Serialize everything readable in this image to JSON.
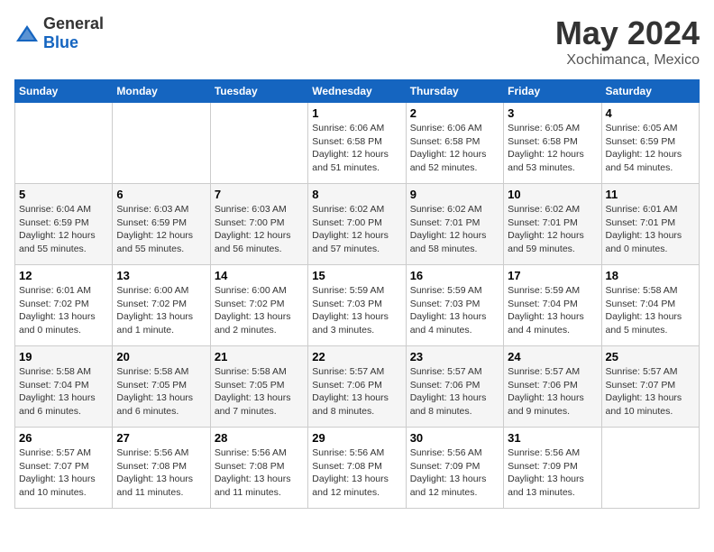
{
  "logo": {
    "general": "General",
    "blue": "Blue"
  },
  "title": "May 2024",
  "subtitle": "Xochimanca, Mexico",
  "days_of_week": [
    "Sunday",
    "Monday",
    "Tuesday",
    "Wednesday",
    "Thursday",
    "Friday",
    "Saturday"
  ],
  "weeks": [
    [
      {
        "day": "",
        "info": ""
      },
      {
        "day": "",
        "info": ""
      },
      {
        "day": "",
        "info": ""
      },
      {
        "day": "1",
        "info": "Sunrise: 6:06 AM\nSunset: 6:58 PM\nDaylight: 12 hours\nand 51 minutes."
      },
      {
        "day": "2",
        "info": "Sunrise: 6:06 AM\nSunset: 6:58 PM\nDaylight: 12 hours\nand 52 minutes."
      },
      {
        "day": "3",
        "info": "Sunrise: 6:05 AM\nSunset: 6:58 PM\nDaylight: 12 hours\nand 53 minutes."
      },
      {
        "day": "4",
        "info": "Sunrise: 6:05 AM\nSunset: 6:59 PM\nDaylight: 12 hours\nand 54 minutes."
      }
    ],
    [
      {
        "day": "5",
        "info": "Sunrise: 6:04 AM\nSunset: 6:59 PM\nDaylight: 12 hours\nand 55 minutes."
      },
      {
        "day": "6",
        "info": "Sunrise: 6:03 AM\nSunset: 6:59 PM\nDaylight: 12 hours\nand 55 minutes."
      },
      {
        "day": "7",
        "info": "Sunrise: 6:03 AM\nSunset: 7:00 PM\nDaylight: 12 hours\nand 56 minutes."
      },
      {
        "day": "8",
        "info": "Sunrise: 6:02 AM\nSunset: 7:00 PM\nDaylight: 12 hours\nand 57 minutes."
      },
      {
        "day": "9",
        "info": "Sunrise: 6:02 AM\nSunset: 7:01 PM\nDaylight: 12 hours\nand 58 minutes."
      },
      {
        "day": "10",
        "info": "Sunrise: 6:02 AM\nSunset: 7:01 PM\nDaylight: 12 hours\nand 59 minutes."
      },
      {
        "day": "11",
        "info": "Sunrise: 6:01 AM\nSunset: 7:01 PM\nDaylight: 13 hours\nand 0 minutes."
      }
    ],
    [
      {
        "day": "12",
        "info": "Sunrise: 6:01 AM\nSunset: 7:02 PM\nDaylight: 13 hours\nand 0 minutes."
      },
      {
        "day": "13",
        "info": "Sunrise: 6:00 AM\nSunset: 7:02 PM\nDaylight: 13 hours\nand 1 minute."
      },
      {
        "day": "14",
        "info": "Sunrise: 6:00 AM\nSunset: 7:02 PM\nDaylight: 13 hours\nand 2 minutes."
      },
      {
        "day": "15",
        "info": "Sunrise: 5:59 AM\nSunset: 7:03 PM\nDaylight: 13 hours\nand 3 minutes."
      },
      {
        "day": "16",
        "info": "Sunrise: 5:59 AM\nSunset: 7:03 PM\nDaylight: 13 hours\nand 4 minutes."
      },
      {
        "day": "17",
        "info": "Sunrise: 5:59 AM\nSunset: 7:04 PM\nDaylight: 13 hours\nand 4 minutes."
      },
      {
        "day": "18",
        "info": "Sunrise: 5:58 AM\nSunset: 7:04 PM\nDaylight: 13 hours\nand 5 minutes."
      }
    ],
    [
      {
        "day": "19",
        "info": "Sunrise: 5:58 AM\nSunset: 7:04 PM\nDaylight: 13 hours\nand 6 minutes."
      },
      {
        "day": "20",
        "info": "Sunrise: 5:58 AM\nSunset: 7:05 PM\nDaylight: 13 hours\nand 6 minutes."
      },
      {
        "day": "21",
        "info": "Sunrise: 5:58 AM\nSunset: 7:05 PM\nDaylight: 13 hours\nand 7 minutes."
      },
      {
        "day": "22",
        "info": "Sunrise: 5:57 AM\nSunset: 7:06 PM\nDaylight: 13 hours\nand 8 minutes."
      },
      {
        "day": "23",
        "info": "Sunrise: 5:57 AM\nSunset: 7:06 PM\nDaylight: 13 hours\nand 8 minutes."
      },
      {
        "day": "24",
        "info": "Sunrise: 5:57 AM\nSunset: 7:06 PM\nDaylight: 13 hours\nand 9 minutes."
      },
      {
        "day": "25",
        "info": "Sunrise: 5:57 AM\nSunset: 7:07 PM\nDaylight: 13 hours\nand 10 minutes."
      }
    ],
    [
      {
        "day": "26",
        "info": "Sunrise: 5:57 AM\nSunset: 7:07 PM\nDaylight: 13 hours\nand 10 minutes."
      },
      {
        "day": "27",
        "info": "Sunrise: 5:56 AM\nSunset: 7:08 PM\nDaylight: 13 hours\nand 11 minutes."
      },
      {
        "day": "28",
        "info": "Sunrise: 5:56 AM\nSunset: 7:08 PM\nDaylight: 13 hours\nand 11 minutes."
      },
      {
        "day": "29",
        "info": "Sunrise: 5:56 AM\nSunset: 7:08 PM\nDaylight: 13 hours\nand 12 minutes."
      },
      {
        "day": "30",
        "info": "Sunrise: 5:56 AM\nSunset: 7:09 PM\nDaylight: 13 hours\nand 12 minutes."
      },
      {
        "day": "31",
        "info": "Sunrise: 5:56 AM\nSunset: 7:09 PM\nDaylight: 13 hours\nand 13 minutes."
      },
      {
        "day": "",
        "info": ""
      }
    ]
  ]
}
